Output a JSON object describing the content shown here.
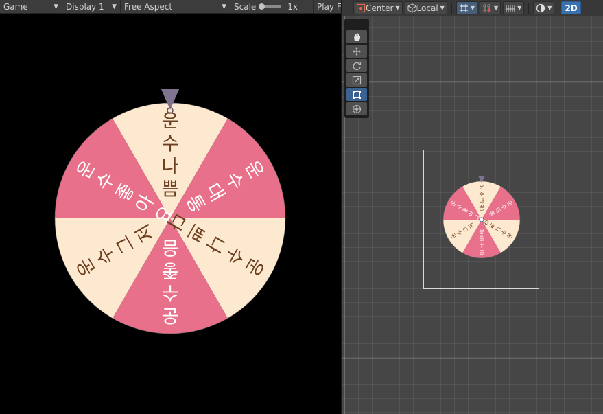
{
  "game_view": {
    "toolbar": {
      "view_dropdown": "Game",
      "display_dropdown": "Display 1",
      "aspect_dropdown": "Free Aspect",
      "scale_label": "Scale",
      "scale_value": "1x",
      "play_focused": "Play F"
    }
  },
  "scene_view": {
    "toolbar": {
      "pivot_label": "Center",
      "space_label": "Local",
      "mode_2d_label": "2D"
    },
    "tools": [
      "hand-tool",
      "move-tool",
      "rotate-tool",
      "scale-tool",
      "rect-tool",
      "transform-tool"
    ],
    "active_tool": "rect-tool"
  },
  "wheel": {
    "pointer_color": "#7e7490",
    "outline_color": "#5c5c5c",
    "text_color_on_light": "#6b3f1f",
    "text_color_on_pink": "#ffffff",
    "segments": [
      {
        "label": "운수나쁨",
        "color": "#fde8d0"
      },
      {
        "label": "운수대통",
        "color": "#e8708a"
      },
      {
        "label": "운수나쁘다",
        "color": "#fde8d0"
      },
      {
        "label": "운수좋음",
        "color": "#e8708a"
      },
      {
        "label": "운수그저",
        "color": "#fde8d0"
      },
      {
        "label": "운수좋아요",
        "color": "#e8708a"
      }
    ]
  },
  "colors": {
    "scene_background": "#464646",
    "toolbar_background": "#3c3c3c",
    "accent_blue": "#3a72b0"
  }
}
